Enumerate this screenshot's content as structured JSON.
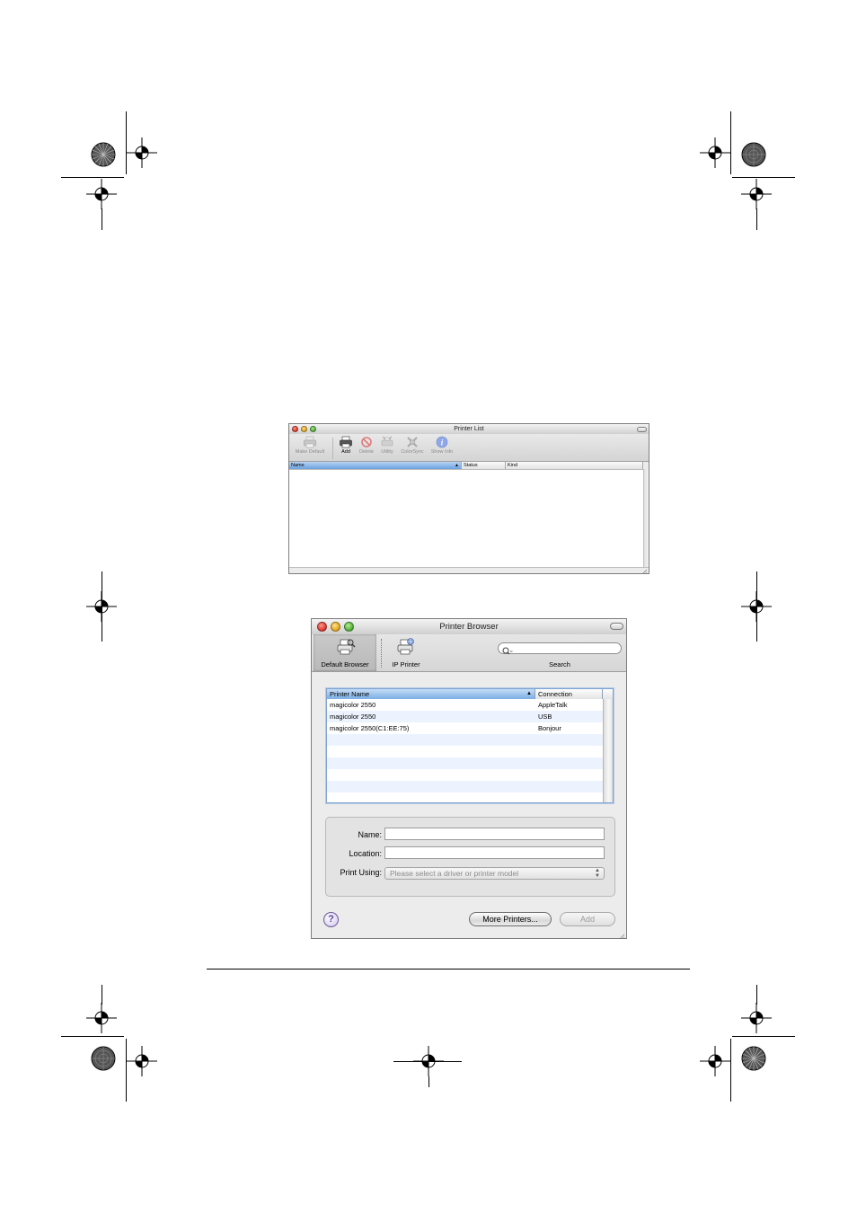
{
  "printer_list_window": {
    "title": "Printer List",
    "toolbar": [
      {
        "label": "Make Default",
        "icon": "printer-icon",
        "enabled": false
      },
      {
        "label": "Add",
        "icon": "add-printer-icon",
        "enabled": true
      },
      {
        "label": "Delete",
        "icon": "delete-icon",
        "enabled": false
      },
      {
        "label": "Utility",
        "icon": "utility-icon",
        "enabled": false
      },
      {
        "label": "ColorSync",
        "icon": "colorsync-icon",
        "enabled": false
      },
      {
        "label": "Show Info",
        "icon": "info-icon",
        "enabled": false
      }
    ],
    "columns": [
      "Name",
      "Status",
      "Kind"
    ]
  },
  "printer_browser_window": {
    "title": "Printer Browser",
    "tabs": [
      {
        "label": "Default Browser",
        "icon": "default-browser-icon",
        "selected": true
      },
      {
        "label": "IP Printer",
        "icon": "ip-printer-icon",
        "selected": false
      }
    ],
    "search": {
      "label": "Search",
      "value": ""
    },
    "table": {
      "columns": [
        "Printer Name",
        "Connection"
      ],
      "rows": [
        {
          "name": "magicolor 2550",
          "connection": "AppleTalk"
        },
        {
          "name": "magicolor 2550",
          "connection": "USB"
        },
        {
          "name": "magicolor 2550(C1:EE:75)",
          "connection": "Bonjour"
        }
      ]
    },
    "form": {
      "name_label": "Name:",
      "name_value": "",
      "location_label": "Location:",
      "location_value": "",
      "print_using_label": "Print Using:",
      "print_using_value": "Please select a driver or printer model"
    },
    "buttons": {
      "help": "?",
      "more_printers": "More Printers...",
      "add": "Add"
    }
  },
  "colors": {
    "selection_blue": "#6aa0e0",
    "row_stripe": "#edf3fe"
  }
}
